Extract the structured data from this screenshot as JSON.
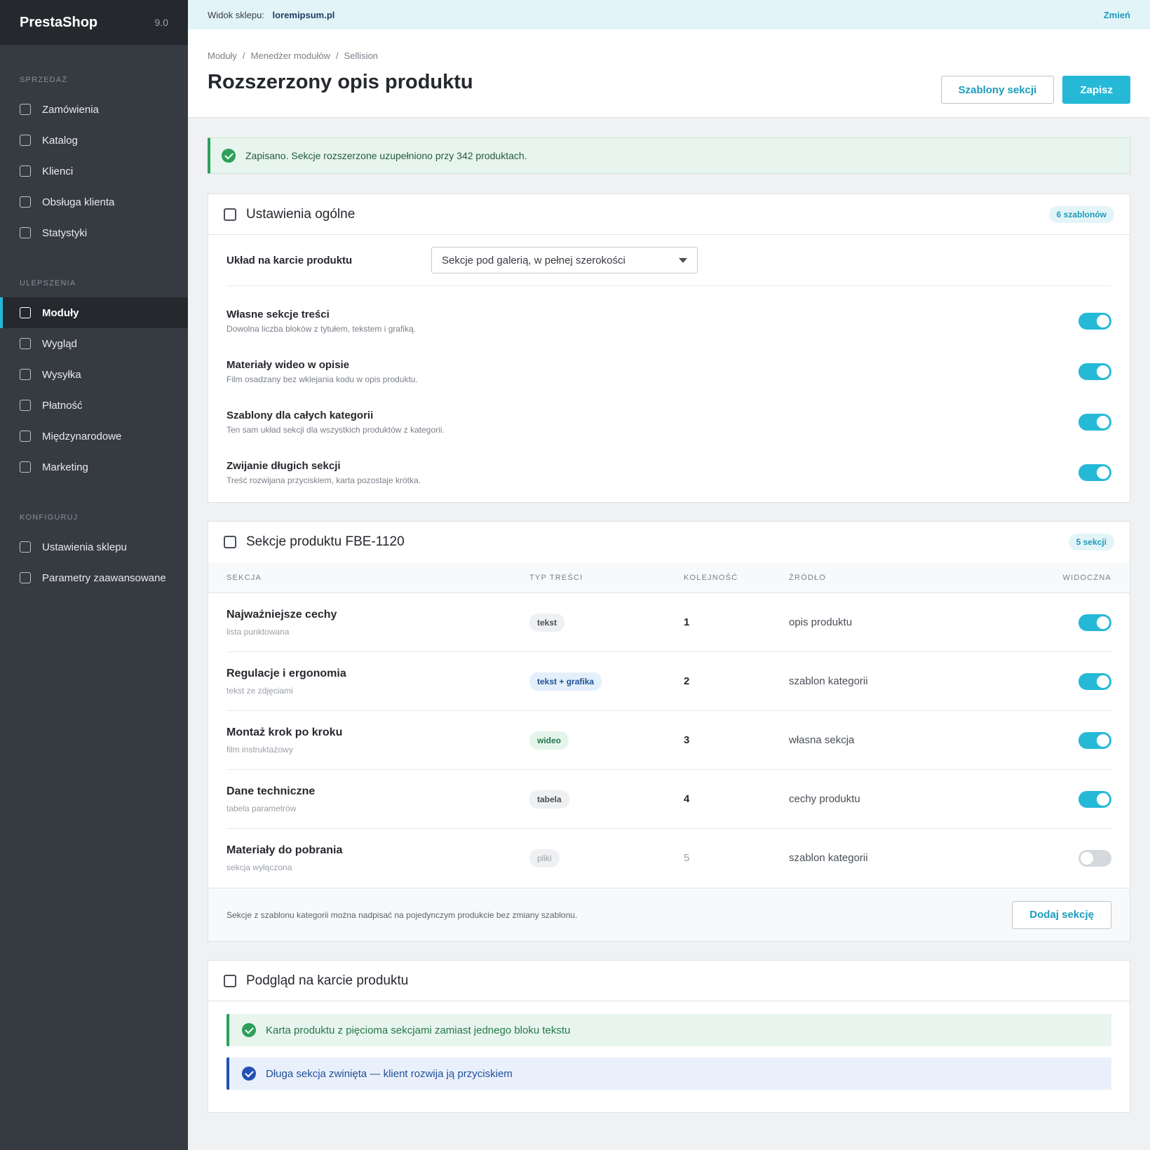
{
  "brand": {
    "name": "PrestaShop",
    "version": "9.0"
  },
  "sidebar": {
    "sections": [
      {
        "title": "SPRZEDAŻ",
        "items": [
          "Zamówienia",
          "Katalog",
          "Klienci",
          "Obsługa klienta",
          "Statystyki"
        ]
      },
      {
        "title": "ULEPSZENIA",
        "items": [
          "Moduły",
          "Wygląd",
          "Wysyłka",
          "Płatność",
          "Międzynarodowe",
          "Marketing"
        ]
      },
      {
        "title": "KONFIGURUJ",
        "items": [
          "Ustawienia sklepu",
          "Parametry zaawansowane"
        ]
      }
    ],
    "active": "Moduły"
  },
  "topbar": {
    "label": "Widok sklepu:",
    "shop": "loremipsum.pl",
    "change": "Zmień"
  },
  "header": {
    "breadcrumb": [
      "Moduły",
      "Menedżer modułów",
      "Sellision"
    ],
    "title": "Rozszerzony opis produktu",
    "btn_templates": "Szablony sekcji",
    "btn_save": "Zapisz"
  },
  "alert": {
    "text": "Zapisano. Sekcje rozszerzone uzupełniono przy 342 produktach."
  },
  "general": {
    "title": "Ustawienia ogólne",
    "badge": "6 szablonów",
    "layout_label": "Układ na karcie produktu",
    "layout_value": "Sekcje pod galerią, w pełnej szerokości",
    "options": [
      {
        "title": "Własne sekcje treści",
        "desc": "Dowolna liczba bloków z tytułem, tekstem i grafiką.",
        "on": true
      },
      {
        "title": "Materiały wideo w opisie",
        "desc": "Film osadzany bez wklejania kodu w opis produktu.",
        "on": true
      },
      {
        "title": "Szablony dla całych kategorii",
        "desc": "Ten sam układ sekcji dla wszystkich produktów z kategorii.",
        "on": true
      },
      {
        "title": "Zwijanie długich sekcji",
        "desc": "Treść rozwijana przyciskiem, karta pozostaje krótka.",
        "on": true
      }
    ]
  },
  "sections": {
    "title": "Sekcje produktu FBE-1120",
    "badge": "5 sekcji",
    "columns": [
      "SEKCJA",
      "TYP TREŚCI",
      "KOLEJNOŚĆ",
      "ŹRÓDŁO",
      "WIDOCZNA"
    ],
    "rows": [
      {
        "name": "Najważniejsze cechy",
        "sub": "lista punktowana",
        "type": "tekst",
        "order": "1",
        "source": "opis produktu",
        "visible": true
      },
      {
        "name": "Regulacje i ergonomia",
        "sub": "tekst ze zdjęciami",
        "type": "tekst + grafika",
        "order": "2",
        "source": "szablon kategorii",
        "visible": true
      },
      {
        "name": "Montaż krok po kroku",
        "sub": "film instruktażowy",
        "type": "wideo",
        "order": "3",
        "source": "własna sekcja",
        "visible": true
      },
      {
        "name": "Dane techniczne",
        "sub": "tabela parametrów",
        "type": "tabela",
        "order": "4",
        "source": "cechy produktu",
        "visible": true
      },
      {
        "name": "Materiały do pobrania",
        "sub": "sekcja wyłączona",
        "type": "pliki",
        "order": "5",
        "source": "szablon kategorii",
        "visible": false
      }
    ],
    "footer_note": "Sekcje z szablonu kategorii można nadpisać na pojedynczym produkcie bez zmiany szablonu.",
    "add_button": "Dodaj sekcję"
  },
  "preview": {
    "title": "Podgląd na karcie produktu",
    "items": [
      "Karta produktu z pięcioma sekcjami zamiast jednego bloku tekstu",
      "Długa sekcja zwinięta — klient rozwija ją przyciskiem"
    ]
  },
  "colors": {
    "accent": "#25b9d7",
    "sidebar": "#363a41",
    "success": "#2ca05a",
    "info": "#2450b5"
  }
}
